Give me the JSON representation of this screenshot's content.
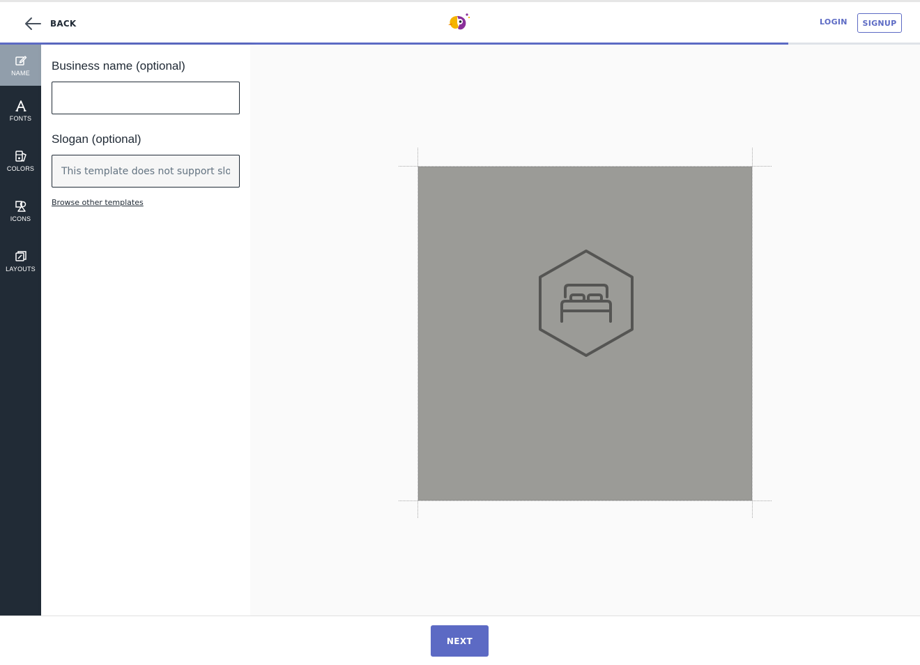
{
  "header": {
    "back_label": "BACK",
    "login_label": "LOGIN",
    "signup_label": "SIGNUP",
    "logo_icon": "parrot-logo-icon"
  },
  "progress": {
    "fraction": 0.857,
    "color": "#5c6ac4"
  },
  "sidebar": {
    "items": [
      {
        "label": "NAME",
        "icon": "edit-icon",
        "active": true
      },
      {
        "label": "FONTS",
        "icon": "font-icon",
        "active": false
      },
      {
        "label": "COLORS",
        "icon": "palette-icon",
        "active": false
      },
      {
        "label": "ICONS",
        "icon": "shapes-icon",
        "active": false
      },
      {
        "label": "LAYOUTS",
        "icon": "layout-icon",
        "active": false
      }
    ]
  },
  "form": {
    "business_name_label": "Business name (optional)",
    "business_name_value": "",
    "slogan_label": "Slogan (optional)",
    "slogan_placeholder": "This template does not support slogans",
    "browse_link": "Browse other templates"
  },
  "preview": {
    "background_color": "#9b9b97",
    "icon": "bed-hexagon-icon",
    "icon_color": "#555553"
  },
  "footer": {
    "next_label": "NEXT"
  },
  "colors": {
    "accent": "#5c6ac4",
    "sidebar_bg": "#212b36",
    "sidebar_active": "#919eab"
  }
}
